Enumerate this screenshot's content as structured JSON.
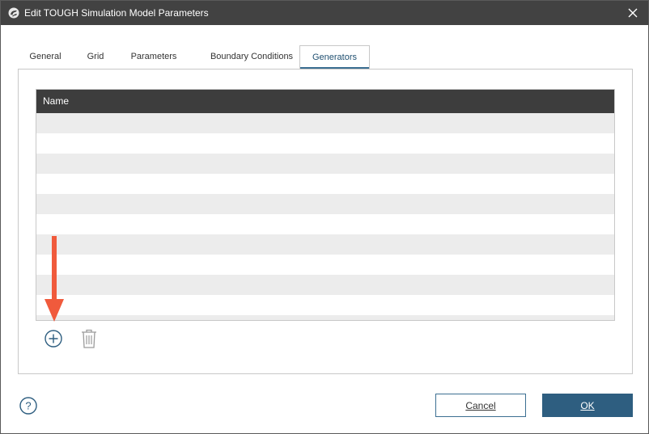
{
  "window": {
    "title": "Edit TOUGH Simulation Model Parameters",
    "app_icon": "leapfrog-app-icon",
    "close_icon": "close-icon"
  },
  "tabs": [
    {
      "label": "General",
      "active": false
    },
    {
      "label": "Grid",
      "active": false
    },
    {
      "label": "Parameters",
      "active": false
    },
    {
      "label": "Boundary Conditions",
      "active": false
    },
    {
      "label": "Generators",
      "active": true
    }
  ],
  "generators_table": {
    "columns": [
      "Name"
    ],
    "rows": []
  },
  "toolbar": {
    "add_icon": "plus-circle-icon",
    "delete_icon": "trash-icon"
  },
  "annotation": {
    "arrow_icon": "down-arrow-callout",
    "arrow_color": "#f05a3c"
  },
  "footer": {
    "help_icon": "help-circle-icon",
    "cancel_label": "Cancel",
    "ok_label": "OK"
  },
  "colors": {
    "titlebar": "#424242",
    "table_header": "#3d3d3d",
    "accent": "#2e5e80",
    "row_stripe": "#ececec"
  }
}
